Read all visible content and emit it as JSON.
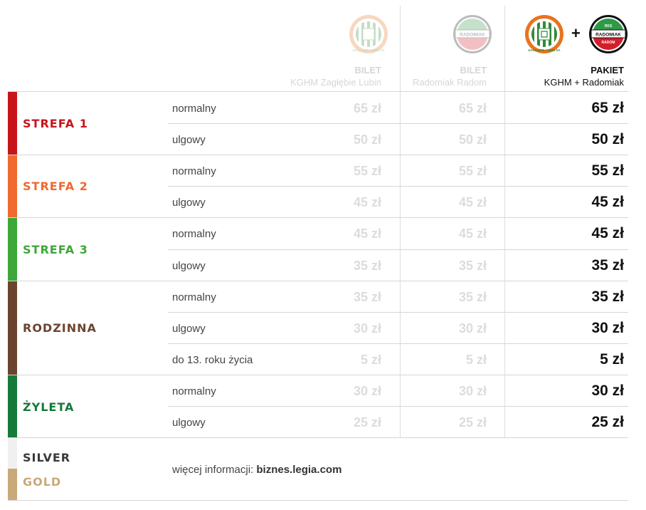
{
  "header": {
    "col1": {
      "line1": "BILET",
      "line2": "KGHM Zagłębie Lubin"
    },
    "col2": {
      "line1": "BILET",
      "line2": "Radomiak Radom"
    },
    "col3": {
      "line1": "PAKIET",
      "line2": "KGHM + Radomiak"
    },
    "plus": "+",
    "zaglebie_logo_text": "ZAGŁĘBIE LUBIN SA",
    "radomiak_logo_text": "RADOMIAK",
    "radomiak_logo_top": "RKS",
    "radomiak_logo_bottom": "RADOM"
  },
  "colors": {
    "strefa1": "#c8151b",
    "strefa2": "#ee6a2f",
    "strefa3": "#3da73a",
    "rodzinna": "#6b4430",
    "zyleta": "#157a3a",
    "silver": "#f0f0f0",
    "gold": "#c9a97a"
  },
  "zones": [
    {
      "name": "STREFA 1",
      "rows": [
        {
          "type": "normalny",
          "kghm": "65 zł",
          "radomiak": "65 zł",
          "pakiet": "65 zł"
        },
        {
          "type": "ulgowy",
          "kghm": "50 zł",
          "radomiak": "50 zł",
          "pakiet": "50 zł"
        }
      ]
    },
    {
      "name": "STREFA 2",
      "rows": [
        {
          "type": "normalny",
          "kghm": "55 zł",
          "radomiak": "55 zł",
          "pakiet": "55 zł"
        },
        {
          "type": "ulgowy",
          "kghm": "45 zł",
          "radomiak": "45 zł",
          "pakiet": "45 zł"
        }
      ]
    },
    {
      "name": "STREFA 3",
      "rows": [
        {
          "type": "normalny",
          "kghm": "45 zł",
          "radomiak": "45 zł",
          "pakiet": "45 zł"
        },
        {
          "type": "ulgowy",
          "kghm": "35 zł",
          "radomiak": "35 zł",
          "pakiet": "35 zł"
        }
      ]
    },
    {
      "name": "RODZINNA",
      "rows": [
        {
          "type": "normalny",
          "kghm": "35 zł",
          "radomiak": "35 zł",
          "pakiet": "35 zł"
        },
        {
          "type": "ulgowy",
          "kghm": "30 zł",
          "radomiak": "30 zł",
          "pakiet": "30 zł"
        },
        {
          "type": "do 13. roku życia",
          "kghm": "5 zł",
          "radomiak": "5 zł",
          "pakiet": "5 zł"
        }
      ]
    },
    {
      "name": "ŻYLETA",
      "rows": [
        {
          "type": "normalny",
          "kghm": "30 zł",
          "radomiak": "30 zł",
          "pakiet": "30 zł"
        },
        {
          "type": "ulgowy",
          "kghm": "25 zł",
          "radomiak": "25 zł",
          "pakiet": "25 zł"
        }
      ]
    }
  ],
  "silver": "SILVER",
  "gold": "GOLD",
  "info": {
    "prefix": "więcej informacji: ",
    "link": "biznes.legia.com"
  }
}
